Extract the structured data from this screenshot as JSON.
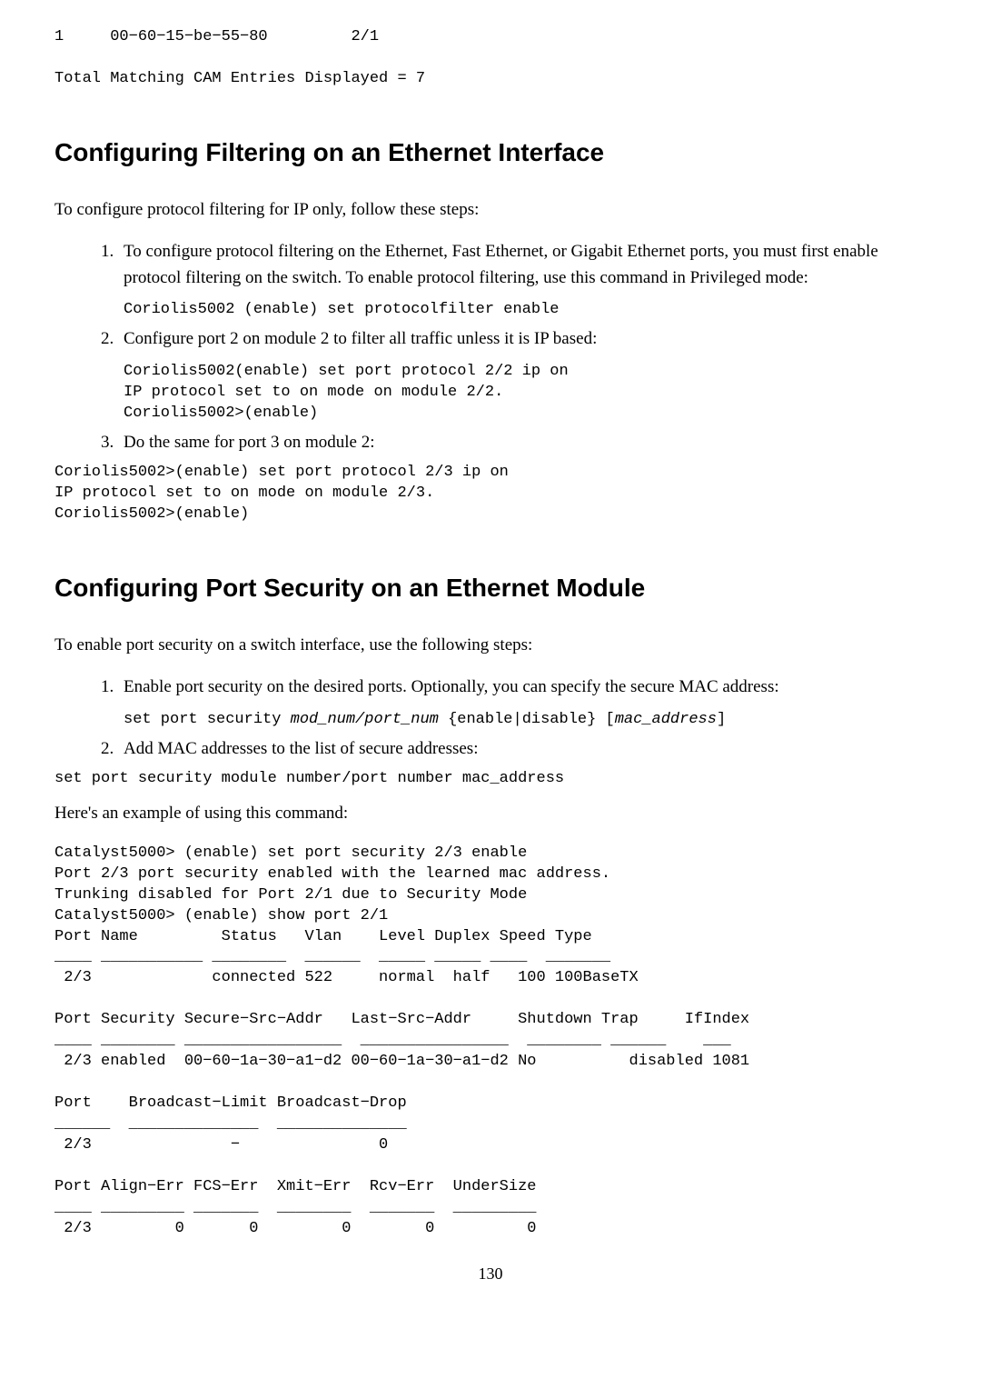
{
  "top_code_block": "1     00−60−15−be−55−80         2/1\n\nTotal Matching CAM Entries Displayed = 7",
  "section1": {
    "heading": "Configuring Filtering on an Ethernet Interface",
    "intro": "To configure protocol filtering for IP only, follow these steps:",
    "step1_text": "To configure protocol filtering on the Ethernet, Fast Ethernet, or Gigabit Ethernet ports, you must first enable protocol filtering on the switch. To enable protocol filtering, use this command in Privileged mode:",
    "step1_code": "Coriolis5002 (enable) set protocolfilter enable",
    "step2_text": "Configure port 2 on module 2 to filter all traffic unless it is IP based:",
    "step2_code": "Coriolis5002(enable) set port protocol 2/2 ip on\nIP protocol set to on mode on module 2/2.\nCoriolis5002>(enable)",
    "step3_text": "Do the same for port 3 on module 2:",
    "bottom_code": "Coriolis5002>(enable) set port protocol 2/3 ip on\nIP protocol set to on mode on module 2/3.\nCoriolis5002>(enable)"
  },
  "section2": {
    "heading": "Configuring Port Security on an Ethernet Module",
    "intro": "To enable port security on a switch interface, use the following steps:",
    "step1_text": "Enable port security on the desired ports. Optionally, you can specify the secure MAC address:",
    "step1_code_prefix": "set port security ",
    "step1_code_italic1": "mod_num/port_num",
    "step1_code_middle": " {enable|disable} [",
    "step1_code_italic2": "mac_address",
    "step1_code_suffix": "]",
    "step2_text": "Add MAC addresses to the list of secure addresses:",
    "after_list_code": "set port security module number/port number mac_address",
    "example_intro": "Here's an example of using this command:",
    "example_code": "Catalyst5000> (enable) set port security 2/3 enable\nPort 2/3 port security enabled with the learned mac address.\nTrunking disabled for Port 2/1 due to Security Mode\nCatalyst5000> (enable) show port 2/1\nPort Name         Status   Vlan    Level Duplex Speed Type\n____ ___________ ________  ______  _____ _____ ____  _______\n 2/3             connected 522     normal  half   100 100BaseTX\n\nPort Security Secure−Src−Addr   Last−Src−Addr     Shutdown Trap     IfIndex\n____ ________ _________________  ________________  ________ ______    ___\n 2/3 enabled  00−60−1a−30−a1−d2 00−60−1a−30−a1−d2 No          disabled 1081\n\nPort    Broadcast−Limit Broadcast−Drop\n______  ______________  ______________\n 2/3               −               0\n\nPort Align−Err FCS−Err  Xmit−Err  Rcv−Err  UnderSize\n____ _________ _______  ________  _______  _________\n 2/3         0       0         0        0          0"
  },
  "page_number": "130"
}
